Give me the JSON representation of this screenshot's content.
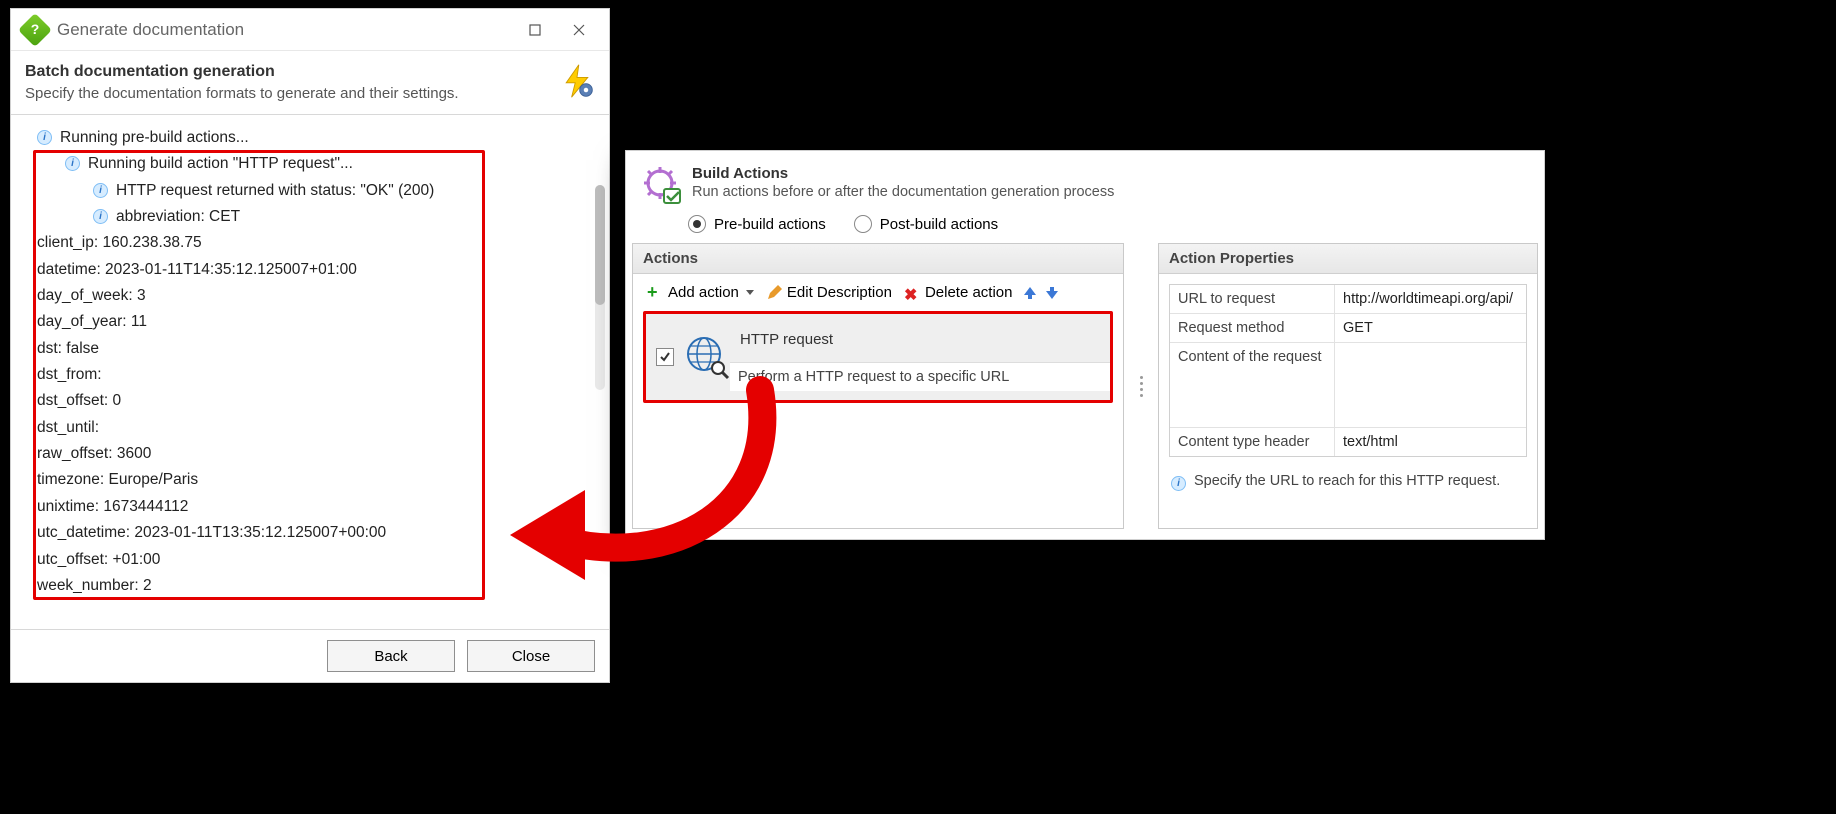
{
  "dialog": {
    "title": "Generate documentation",
    "banner": {
      "heading": "Batch documentation generation",
      "sub": "Specify the documentation formats to generate and their settings."
    },
    "log": {
      "line_root": "Running pre-build actions...",
      "line_build": "Running build action \"HTTP request\"...",
      "line_status": "HTTP request returned with status: \"OK\" (200)",
      "line_abbr": "abbreviation: CET",
      "kv": {
        "client_ip": "client_ip: 160.238.38.75",
        "datetime": "datetime: 2023-01-11T14:35:12.125007+01:00",
        "day_of_week": "day_of_week: 3",
        "day_of_year": "day_of_year: 11",
        "dst": "dst: false",
        "dst_from": "dst_from:",
        "dst_offset": "dst_offset: 0",
        "dst_until": "dst_until:",
        "raw_offset": "raw_offset: 3600",
        "timezone": "timezone: Europe/Paris",
        "unixtime": "unixtime: 1673444112",
        "utc_datetime": "utc_datetime: 2023-01-11T13:35:12.125007+00:00",
        "utc_offset": "utc_offset: +01:00",
        "week_number": "week_number: 2"
      }
    },
    "buttons": {
      "back": "Back",
      "close": "Close"
    }
  },
  "build": {
    "title": "Build Actions",
    "sub": "Run actions before or after the documentation generation process",
    "radio_pre": "Pre-build actions",
    "radio_post": "Post-build actions",
    "actions_panel": "Actions",
    "props_panel": "Action Properties",
    "toolbar": {
      "add": "Add action",
      "edit": "Edit Description",
      "del": "Delete action"
    },
    "action": {
      "name": "HTTP request",
      "desc": "Perform a HTTP request to a specific URL"
    },
    "props": {
      "url_label": "URL to request",
      "url_value": "http://worldtimeapi.org/api/",
      "method_label": "Request method",
      "method_value": "GET",
      "content_label": "Content of the request",
      "content_value": "",
      "ctype_label": "Content type header",
      "ctype_value": "text/html"
    },
    "help": "Specify the URL to reach for this HTTP request."
  }
}
